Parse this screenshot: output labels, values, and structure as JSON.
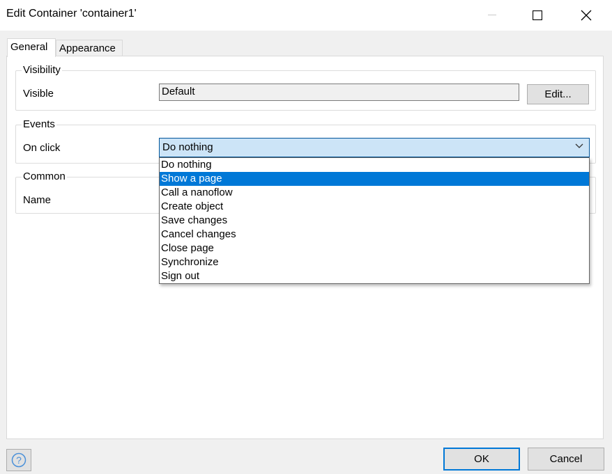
{
  "window": {
    "title": "Edit Container 'container1'"
  },
  "tabs": [
    {
      "label": "General",
      "active": true
    },
    {
      "label": "Appearance",
      "active": false
    }
  ],
  "visibility": {
    "group_title": "Visibility",
    "visible_label": "Visible",
    "visible_value": "Default",
    "edit_button": "Edit..."
  },
  "events": {
    "group_title": "Events",
    "onclick_label": "On click",
    "onclick_value": "Do nothing",
    "options": [
      "Do nothing",
      "Show a page",
      "Call a nanoflow",
      "Create object",
      "Save changes",
      "Cancel changes",
      "Close page",
      "Synchronize",
      "Sign out"
    ],
    "highlighted_option": "Show a page"
  },
  "common": {
    "group_title": "Common",
    "name_label": "Name"
  },
  "footer": {
    "ok_label": "OK",
    "cancel_label": "Cancel"
  },
  "colors": {
    "selection": "#0078d7",
    "combo_bg": "#cce4f7",
    "combo_border": "#005499",
    "help_icon": "#4a90d9"
  }
}
